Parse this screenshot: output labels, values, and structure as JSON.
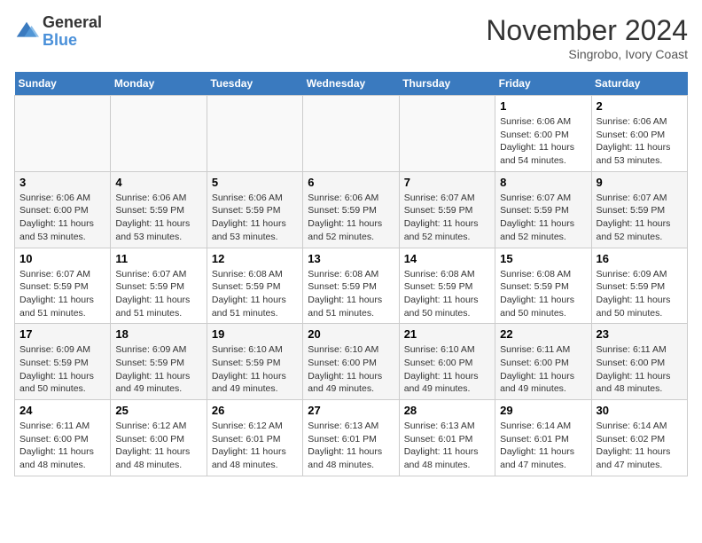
{
  "header": {
    "logo_line1": "General",
    "logo_line2": "Blue",
    "month": "November 2024",
    "location": "Singrobo, Ivory Coast"
  },
  "weekdays": [
    "Sunday",
    "Monday",
    "Tuesday",
    "Wednesday",
    "Thursday",
    "Friday",
    "Saturday"
  ],
  "weeks": [
    [
      {
        "day": "",
        "info": ""
      },
      {
        "day": "",
        "info": ""
      },
      {
        "day": "",
        "info": ""
      },
      {
        "day": "",
        "info": ""
      },
      {
        "day": "",
        "info": ""
      },
      {
        "day": "1",
        "info": "Sunrise: 6:06 AM\nSunset: 6:00 PM\nDaylight: 11 hours\nand 54 minutes."
      },
      {
        "day": "2",
        "info": "Sunrise: 6:06 AM\nSunset: 6:00 PM\nDaylight: 11 hours\nand 53 minutes."
      }
    ],
    [
      {
        "day": "3",
        "info": "Sunrise: 6:06 AM\nSunset: 6:00 PM\nDaylight: 11 hours\nand 53 minutes."
      },
      {
        "day": "4",
        "info": "Sunrise: 6:06 AM\nSunset: 5:59 PM\nDaylight: 11 hours\nand 53 minutes."
      },
      {
        "day": "5",
        "info": "Sunrise: 6:06 AM\nSunset: 5:59 PM\nDaylight: 11 hours\nand 53 minutes."
      },
      {
        "day": "6",
        "info": "Sunrise: 6:06 AM\nSunset: 5:59 PM\nDaylight: 11 hours\nand 52 minutes."
      },
      {
        "day": "7",
        "info": "Sunrise: 6:07 AM\nSunset: 5:59 PM\nDaylight: 11 hours\nand 52 minutes."
      },
      {
        "day": "8",
        "info": "Sunrise: 6:07 AM\nSunset: 5:59 PM\nDaylight: 11 hours\nand 52 minutes."
      },
      {
        "day": "9",
        "info": "Sunrise: 6:07 AM\nSunset: 5:59 PM\nDaylight: 11 hours\nand 52 minutes."
      }
    ],
    [
      {
        "day": "10",
        "info": "Sunrise: 6:07 AM\nSunset: 5:59 PM\nDaylight: 11 hours\nand 51 minutes."
      },
      {
        "day": "11",
        "info": "Sunrise: 6:07 AM\nSunset: 5:59 PM\nDaylight: 11 hours\nand 51 minutes."
      },
      {
        "day": "12",
        "info": "Sunrise: 6:08 AM\nSunset: 5:59 PM\nDaylight: 11 hours\nand 51 minutes."
      },
      {
        "day": "13",
        "info": "Sunrise: 6:08 AM\nSunset: 5:59 PM\nDaylight: 11 hours\nand 51 minutes."
      },
      {
        "day": "14",
        "info": "Sunrise: 6:08 AM\nSunset: 5:59 PM\nDaylight: 11 hours\nand 50 minutes."
      },
      {
        "day": "15",
        "info": "Sunrise: 6:08 AM\nSunset: 5:59 PM\nDaylight: 11 hours\nand 50 minutes."
      },
      {
        "day": "16",
        "info": "Sunrise: 6:09 AM\nSunset: 5:59 PM\nDaylight: 11 hours\nand 50 minutes."
      }
    ],
    [
      {
        "day": "17",
        "info": "Sunrise: 6:09 AM\nSunset: 5:59 PM\nDaylight: 11 hours\nand 50 minutes."
      },
      {
        "day": "18",
        "info": "Sunrise: 6:09 AM\nSunset: 5:59 PM\nDaylight: 11 hours\nand 49 minutes."
      },
      {
        "day": "19",
        "info": "Sunrise: 6:10 AM\nSunset: 5:59 PM\nDaylight: 11 hours\nand 49 minutes."
      },
      {
        "day": "20",
        "info": "Sunrise: 6:10 AM\nSunset: 6:00 PM\nDaylight: 11 hours\nand 49 minutes."
      },
      {
        "day": "21",
        "info": "Sunrise: 6:10 AM\nSunset: 6:00 PM\nDaylight: 11 hours\nand 49 minutes."
      },
      {
        "day": "22",
        "info": "Sunrise: 6:11 AM\nSunset: 6:00 PM\nDaylight: 11 hours\nand 49 minutes."
      },
      {
        "day": "23",
        "info": "Sunrise: 6:11 AM\nSunset: 6:00 PM\nDaylight: 11 hours\nand 48 minutes."
      }
    ],
    [
      {
        "day": "24",
        "info": "Sunrise: 6:11 AM\nSunset: 6:00 PM\nDaylight: 11 hours\nand 48 minutes."
      },
      {
        "day": "25",
        "info": "Sunrise: 6:12 AM\nSunset: 6:00 PM\nDaylight: 11 hours\nand 48 minutes."
      },
      {
        "day": "26",
        "info": "Sunrise: 6:12 AM\nSunset: 6:01 PM\nDaylight: 11 hours\nand 48 minutes."
      },
      {
        "day": "27",
        "info": "Sunrise: 6:13 AM\nSunset: 6:01 PM\nDaylight: 11 hours\nand 48 minutes."
      },
      {
        "day": "28",
        "info": "Sunrise: 6:13 AM\nSunset: 6:01 PM\nDaylight: 11 hours\nand 48 minutes."
      },
      {
        "day": "29",
        "info": "Sunrise: 6:14 AM\nSunset: 6:01 PM\nDaylight: 11 hours\nand 47 minutes."
      },
      {
        "day": "30",
        "info": "Sunrise: 6:14 AM\nSunset: 6:02 PM\nDaylight: 11 hours\nand 47 minutes."
      }
    ]
  ]
}
